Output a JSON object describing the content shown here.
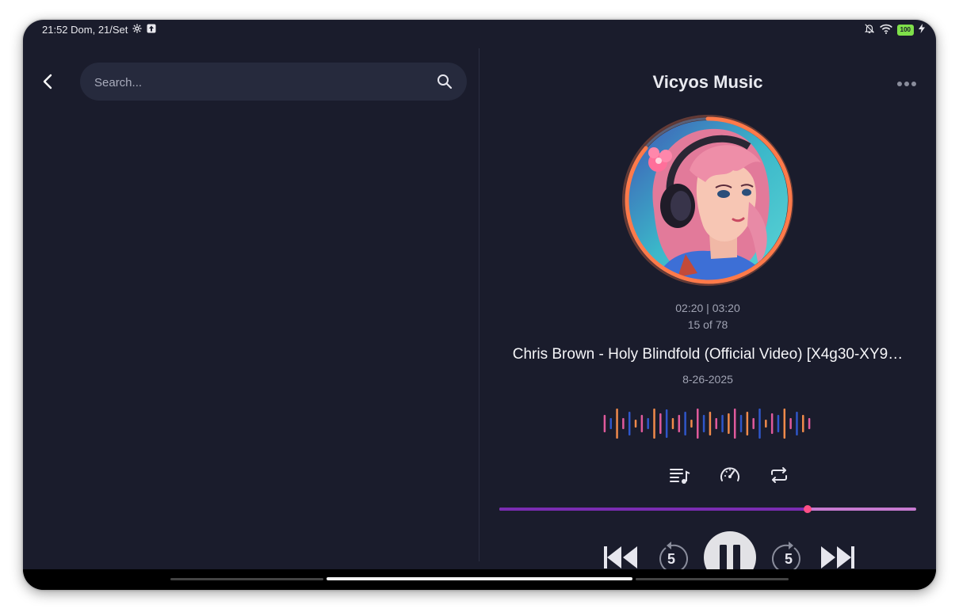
{
  "status_bar": {
    "time_date": "21:52 Dom, 21/Set",
    "battery_level": "100"
  },
  "search": {
    "placeholder": "Search..."
  },
  "player": {
    "app_title": "Vicyos Music",
    "elapsed_time": "02:20",
    "total_time": "03:20",
    "time_display": "02:20 | 03:20",
    "track_position": "15 of 78",
    "track_title": "Chris Brown - Holy Blindfold (Official Video) [X4g30-XY9…",
    "track_date": "8-26-2025",
    "progress_fraction": 0.74
  },
  "icons": {
    "back": "chevron-left-icon",
    "search": "search-icon",
    "more": "more-horizontal-icon",
    "queue": "playlist-music-icon",
    "speed": "speedometer-icon",
    "repeat": "repeat-icon",
    "previous": "skip-previous-icon",
    "rewind": "replay-5-icon",
    "pause": "pause-icon",
    "forward": "forward-5-icon",
    "next": "skip-next-icon"
  },
  "rewind_seconds": "5",
  "forward_seconds": "5",
  "colors": {
    "background": "#1a1c2c",
    "surface": "#262a3d",
    "progress_played": "#7a2cb2",
    "progress_remaining": "#c77ad0",
    "progress_thumb": "#ff4f86",
    "album_ring": "#ff7a4a",
    "visualizer_pink": "#e05a9c",
    "visualizer_blue": "#2f56c9",
    "visualizer_orange": "#f08a4b"
  }
}
